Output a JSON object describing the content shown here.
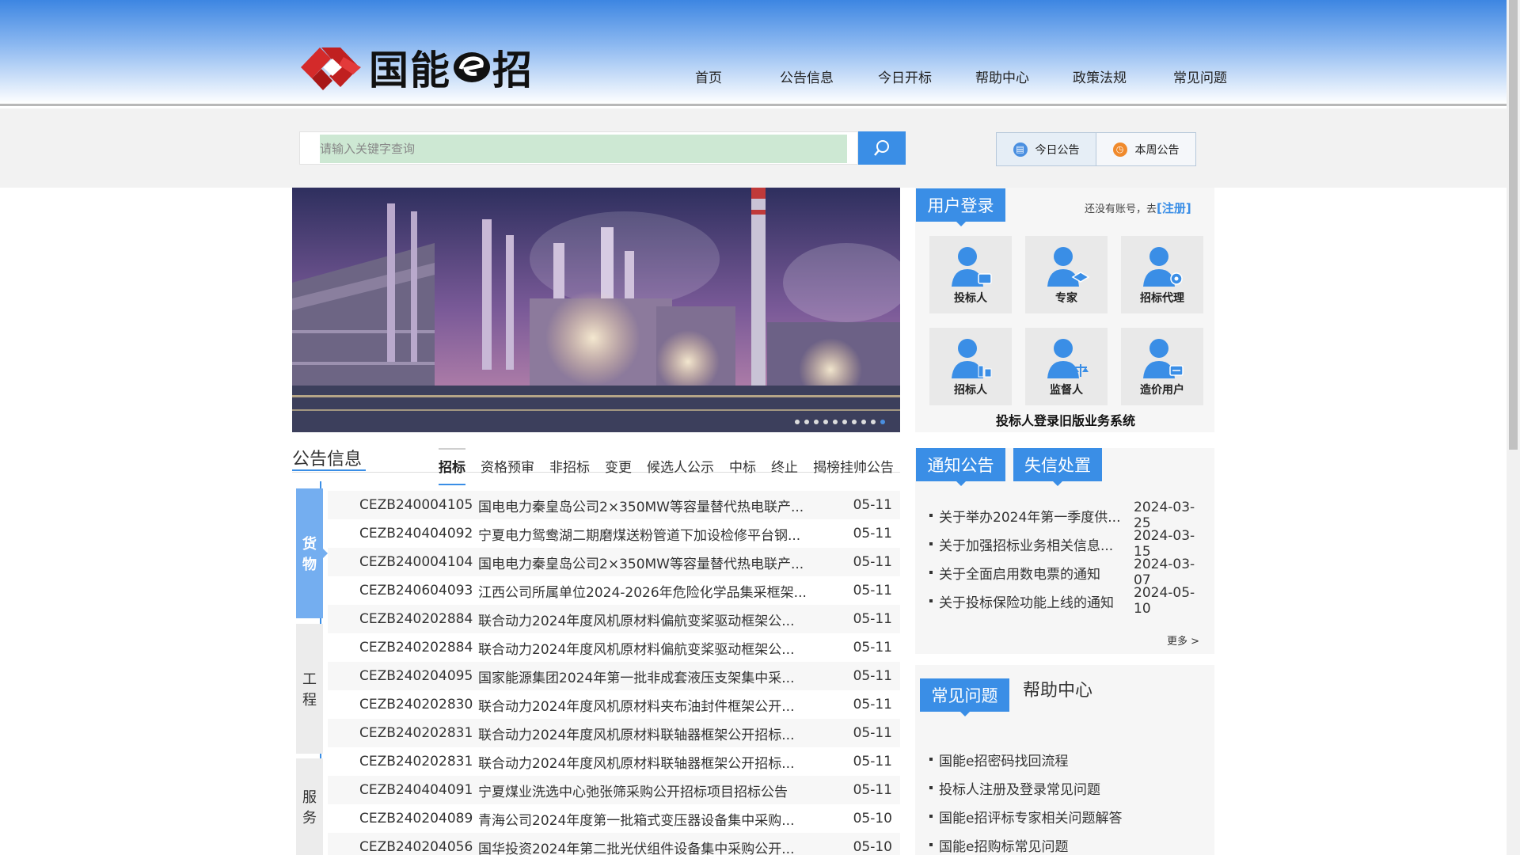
{
  "logo": {
    "text_left": "国能",
    "text_right": "招",
    "brand_color": "#d42a2a"
  },
  "nav": {
    "items": [
      "首页",
      "公告信息",
      "今日开标",
      "帮助中心",
      "政策法规",
      "常见问题"
    ]
  },
  "search": {
    "placeholder": "请输入关键字查询",
    "icon": "search-icon"
  },
  "quick": {
    "today_label": "今日公告",
    "week_label": "本周公告"
  },
  "banner": {
    "slide_count": 10
  },
  "login": {
    "title": "用户登录",
    "no_account": "还没有账号，去",
    "register": "[注册]",
    "roles": [
      "投标人",
      "专家",
      "招标代理",
      "招标人",
      "监督人",
      "造价用户"
    ],
    "old_system": "投标人登录旧版业务系统"
  },
  "announcements": {
    "title": "公告信息",
    "tabs": [
      "招标",
      "资格预审",
      "非招标",
      "变更",
      "候选人公示",
      "中标",
      "终止",
      "揭榜挂帅公告"
    ],
    "active_tab": "招标",
    "categories": {
      "goods": [
        "货",
        "物"
      ],
      "engineering": [
        "工",
        "程"
      ],
      "service": [
        "服",
        "务"
      ]
    },
    "rows": [
      {
        "code": "CEZB240004105",
        "title": "国电电力秦皇岛公司2×350MW等容量替代热电联产...",
        "date": "05-11"
      },
      {
        "code": "CEZB240404092",
        "title": "宁夏电力鸳鸯湖二期磨煤送粉管道下加设检修平台钢...",
        "date": "05-11"
      },
      {
        "code": "CEZB240004104",
        "title": "国电电力秦皇岛公司2×350MW等容量替代热电联产...",
        "date": "05-11"
      },
      {
        "code": "CEZB240604093",
        "title": "江西公司所属单位2024-2026年危险化学品集采框架...",
        "date": "05-11"
      },
      {
        "code": "CEZB240202884",
        "title": "联合动力2024年度风机原材料偏航变桨驱动框架公...",
        "date": "05-11"
      },
      {
        "code": "CEZB240202884",
        "title": "联合动力2024年度风机原材料偏航变桨驱动框架公...",
        "date": "05-11"
      },
      {
        "code": "CEZB240204095",
        "title": "国家能源集团2024年第一批非成套液压支架集中采...",
        "date": "05-11"
      },
      {
        "code": "CEZB240202830",
        "title": "联合动力2024年度风机原材料夹布油封件框架公开...",
        "date": "05-11"
      },
      {
        "code": "CEZB240202831",
        "title": "联合动力2024年度风机原材料联轴器框架公开招标...",
        "date": "05-11"
      },
      {
        "code": "CEZB240202831",
        "title": "联合动力2024年度风机原材料联轴器框架公开招标...",
        "date": "05-11"
      },
      {
        "code": "CEZB240404091",
        "title": "宁夏煤业洗选中心弛张筛采购公开招标项目招标公告",
        "date": "05-11"
      },
      {
        "code": "CEZB240204089",
        "title": "青海公司2024年度第一批箱式变压器设备集中采购...",
        "date": "05-10"
      },
      {
        "code": "CEZB240204056",
        "title": "国华投资2024年第二批光伏组件设备集中采购公开...",
        "date": "05-10"
      }
    ]
  },
  "notices": {
    "tab_notice": "通知公告",
    "tab_credit": "失信处置",
    "rows": [
      {
        "title": "关于举办2024年第一季度供...",
        "date": "2024-03-25"
      },
      {
        "title": "关于加强招标业务相关信息...",
        "date": "2024-03-15"
      },
      {
        "title": "关于全面启用数电票的通知",
        "date": "2024-03-07"
      },
      {
        "title": "关于投标保险功能上线的通知",
        "date": "2024-05-10"
      }
    ],
    "more": "更多 >"
  },
  "faq": {
    "tab_faq": "常见问题",
    "help_center": "帮助中心",
    "rows": [
      "国能e招密码找回流程",
      "投标人注册及登录常见问题",
      "国能e招评标专家相关问题解答",
      "国能e招购标常见问题"
    ]
  }
}
